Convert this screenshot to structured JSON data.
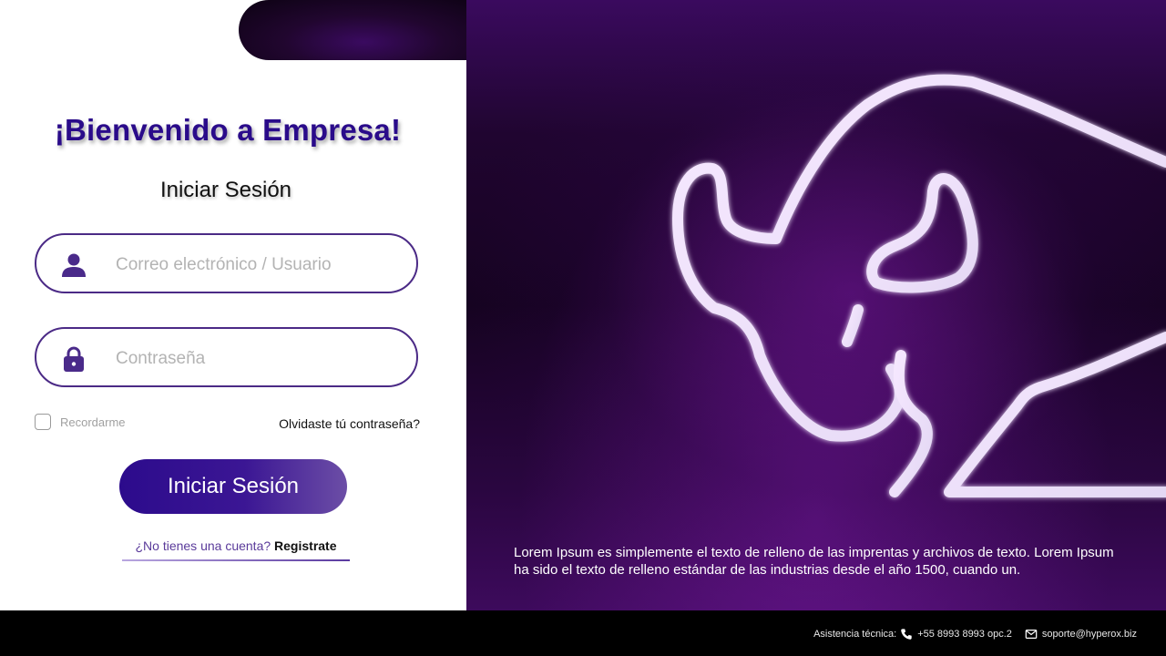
{
  "login": {
    "welcome_title": "¡Bienvenido a Empresa!",
    "subtitle": "Iniciar Sesión",
    "username_placeholder": "Correo electrónico / Usuario",
    "password_placeholder": "Contraseña",
    "remember_label": "Recordarme",
    "forgot_link": "Olvidaste tú contraseña?",
    "submit_label": "Iniciar Sesión",
    "register_prompt": "¿No tienes una cuenta?",
    "register_link": "Registrate"
  },
  "hero": {
    "description": "Lorem Ipsum es simplemente el texto de relleno de las imprentas y archivos de texto. Lorem Ipsum ha sido el texto de relleno estándar de las industrias desde el año 1500, cuando un."
  },
  "footer": {
    "support_label": "Asistencia técnica:",
    "phone": "+55 8993 8993 opc.2",
    "email": "soporte@hyperox.biz"
  },
  "icons": {
    "username": "user-icon",
    "password": "lock-icon",
    "phone": "phone-icon",
    "email": "mail-icon",
    "logo": "bull-logo"
  },
  "colors": {
    "brand_primary": "#2a0b8a",
    "input_border": "#4b2a86",
    "hero_background": "#1e0430",
    "footer_background": "#000000"
  }
}
